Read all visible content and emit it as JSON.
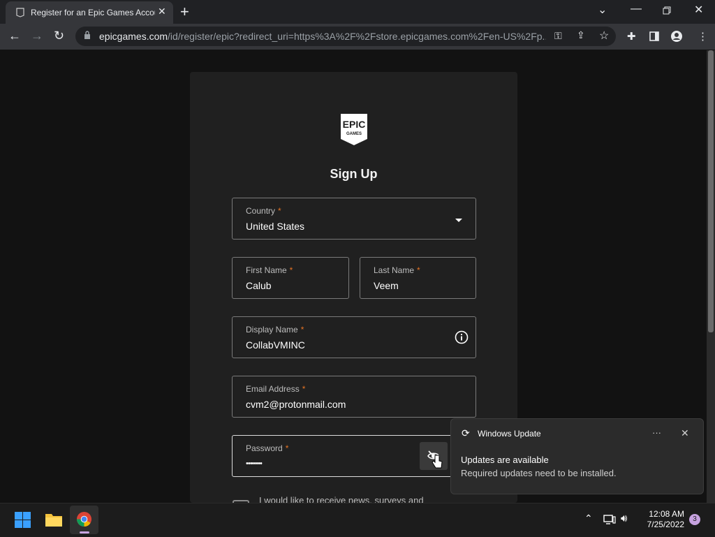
{
  "browser": {
    "tab_title": "Register for an Epic Games Accou",
    "tab_favicon": "epic-games-favicon",
    "url_host": "epicgames.com",
    "url_rest": "/id/register/epic?redirect_uri=https%3A%2F%2Fstore.epicgames.com%2Fen-US%2Fp..."
  },
  "logo": {
    "line1": "EPIC",
    "line2": "GAMES"
  },
  "page": {
    "heading": "Sign Up",
    "required_marker": "*",
    "fields": {
      "country": {
        "label": "Country",
        "value": "United States"
      },
      "first_name": {
        "label": "First Name",
        "value": "Calub"
      },
      "last_name": {
        "label": "Last Name",
        "value": "Veem"
      },
      "display_name": {
        "label": "Display Name",
        "value": "CollabVMINC"
      },
      "email": {
        "label": "Email Address",
        "value": "cvm2@protonmail.com"
      },
      "password": {
        "label": "Password",
        "value": "••••••••"
      }
    },
    "newsletter_text": "I would like to receive news, surveys and"
  },
  "toast": {
    "app": "Windows Update",
    "more": "···",
    "heading": "Updates are available",
    "body": "Required updates need to be installed."
  },
  "taskbar": {
    "time": "12:08 AM",
    "date": "7/25/2022",
    "notification_count": "3"
  },
  "colors": {
    "accent_required": "#e57324",
    "card_bg": "#202020",
    "page_bg": "#121212"
  }
}
